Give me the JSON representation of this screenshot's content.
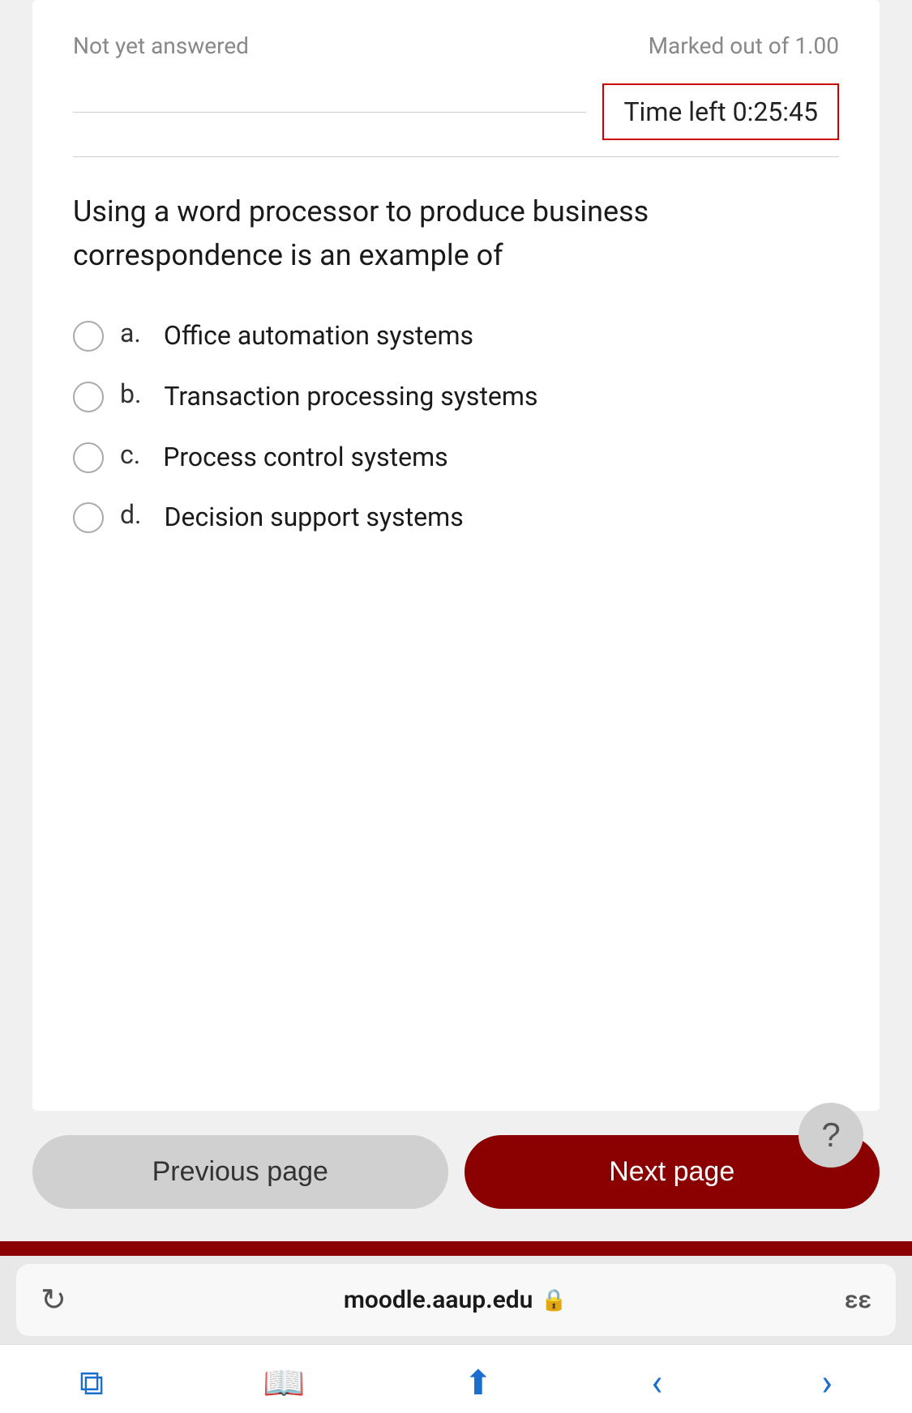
{
  "question": {
    "status_label": "Not yet answered",
    "marks_label": "Marked out of 1.00",
    "time_left_label": "Time left 0:25:45",
    "question_text": "Using a word processor to produce business correspondence is an example of",
    "options": [
      {
        "letter": "a.",
        "text": "Office automation systems"
      },
      {
        "letter": "b.",
        "text": "Transaction processing systems"
      },
      {
        "letter": "c.",
        "text": "Process control systems"
      },
      {
        "letter": "d.",
        "text": "Decision support systems"
      }
    ]
  },
  "navigation": {
    "prev_label": "Previous page",
    "next_label": "Next page",
    "help_label": "?"
  },
  "browser": {
    "url": "moodle.aaup.edu",
    "text_size": "εε"
  }
}
